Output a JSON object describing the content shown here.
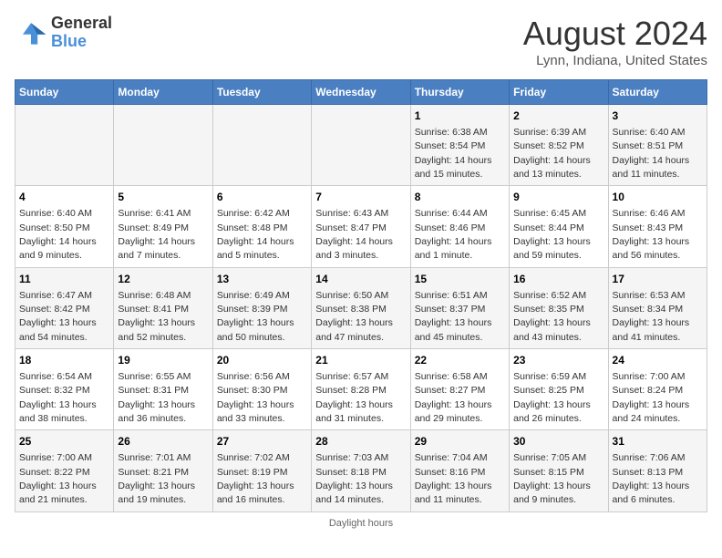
{
  "header": {
    "logo_line1": "General",
    "logo_line2": "Blue",
    "month": "August 2024",
    "location": "Lynn, Indiana, United States"
  },
  "days_of_week": [
    "Sunday",
    "Monday",
    "Tuesday",
    "Wednesday",
    "Thursday",
    "Friday",
    "Saturday"
  ],
  "weeks": [
    [
      {
        "day": "",
        "info": ""
      },
      {
        "day": "",
        "info": ""
      },
      {
        "day": "",
        "info": ""
      },
      {
        "day": "",
        "info": ""
      },
      {
        "day": "1",
        "info": "Sunrise: 6:38 AM\nSunset: 8:54 PM\nDaylight: 14 hours and 15 minutes."
      },
      {
        "day": "2",
        "info": "Sunrise: 6:39 AM\nSunset: 8:52 PM\nDaylight: 14 hours and 13 minutes."
      },
      {
        "day": "3",
        "info": "Sunrise: 6:40 AM\nSunset: 8:51 PM\nDaylight: 14 hours and 11 minutes."
      }
    ],
    [
      {
        "day": "4",
        "info": "Sunrise: 6:40 AM\nSunset: 8:50 PM\nDaylight: 14 hours and 9 minutes."
      },
      {
        "day": "5",
        "info": "Sunrise: 6:41 AM\nSunset: 8:49 PM\nDaylight: 14 hours and 7 minutes."
      },
      {
        "day": "6",
        "info": "Sunrise: 6:42 AM\nSunset: 8:48 PM\nDaylight: 14 hours and 5 minutes."
      },
      {
        "day": "7",
        "info": "Sunrise: 6:43 AM\nSunset: 8:47 PM\nDaylight: 14 hours and 3 minutes."
      },
      {
        "day": "8",
        "info": "Sunrise: 6:44 AM\nSunset: 8:46 PM\nDaylight: 14 hours and 1 minute."
      },
      {
        "day": "9",
        "info": "Sunrise: 6:45 AM\nSunset: 8:44 PM\nDaylight: 13 hours and 59 minutes."
      },
      {
        "day": "10",
        "info": "Sunrise: 6:46 AM\nSunset: 8:43 PM\nDaylight: 13 hours and 56 minutes."
      }
    ],
    [
      {
        "day": "11",
        "info": "Sunrise: 6:47 AM\nSunset: 8:42 PM\nDaylight: 13 hours and 54 minutes."
      },
      {
        "day": "12",
        "info": "Sunrise: 6:48 AM\nSunset: 8:41 PM\nDaylight: 13 hours and 52 minutes."
      },
      {
        "day": "13",
        "info": "Sunrise: 6:49 AM\nSunset: 8:39 PM\nDaylight: 13 hours and 50 minutes."
      },
      {
        "day": "14",
        "info": "Sunrise: 6:50 AM\nSunset: 8:38 PM\nDaylight: 13 hours and 47 minutes."
      },
      {
        "day": "15",
        "info": "Sunrise: 6:51 AM\nSunset: 8:37 PM\nDaylight: 13 hours and 45 minutes."
      },
      {
        "day": "16",
        "info": "Sunrise: 6:52 AM\nSunset: 8:35 PM\nDaylight: 13 hours and 43 minutes."
      },
      {
        "day": "17",
        "info": "Sunrise: 6:53 AM\nSunset: 8:34 PM\nDaylight: 13 hours and 41 minutes."
      }
    ],
    [
      {
        "day": "18",
        "info": "Sunrise: 6:54 AM\nSunset: 8:32 PM\nDaylight: 13 hours and 38 minutes."
      },
      {
        "day": "19",
        "info": "Sunrise: 6:55 AM\nSunset: 8:31 PM\nDaylight: 13 hours and 36 minutes."
      },
      {
        "day": "20",
        "info": "Sunrise: 6:56 AM\nSunset: 8:30 PM\nDaylight: 13 hours and 33 minutes."
      },
      {
        "day": "21",
        "info": "Sunrise: 6:57 AM\nSunset: 8:28 PM\nDaylight: 13 hours and 31 minutes."
      },
      {
        "day": "22",
        "info": "Sunrise: 6:58 AM\nSunset: 8:27 PM\nDaylight: 13 hours and 29 minutes."
      },
      {
        "day": "23",
        "info": "Sunrise: 6:59 AM\nSunset: 8:25 PM\nDaylight: 13 hours and 26 minutes."
      },
      {
        "day": "24",
        "info": "Sunrise: 7:00 AM\nSunset: 8:24 PM\nDaylight: 13 hours and 24 minutes."
      }
    ],
    [
      {
        "day": "25",
        "info": "Sunrise: 7:00 AM\nSunset: 8:22 PM\nDaylight: 13 hours and 21 minutes."
      },
      {
        "day": "26",
        "info": "Sunrise: 7:01 AM\nSunset: 8:21 PM\nDaylight: 13 hours and 19 minutes."
      },
      {
        "day": "27",
        "info": "Sunrise: 7:02 AM\nSunset: 8:19 PM\nDaylight: 13 hours and 16 minutes."
      },
      {
        "day": "28",
        "info": "Sunrise: 7:03 AM\nSunset: 8:18 PM\nDaylight: 13 hours and 14 minutes."
      },
      {
        "day": "29",
        "info": "Sunrise: 7:04 AM\nSunset: 8:16 PM\nDaylight: 13 hours and 11 minutes."
      },
      {
        "day": "30",
        "info": "Sunrise: 7:05 AM\nSunset: 8:15 PM\nDaylight: 13 hours and 9 minutes."
      },
      {
        "day": "31",
        "info": "Sunrise: 7:06 AM\nSunset: 8:13 PM\nDaylight: 13 hours and 6 minutes."
      }
    ]
  ],
  "footer": "Daylight hours"
}
